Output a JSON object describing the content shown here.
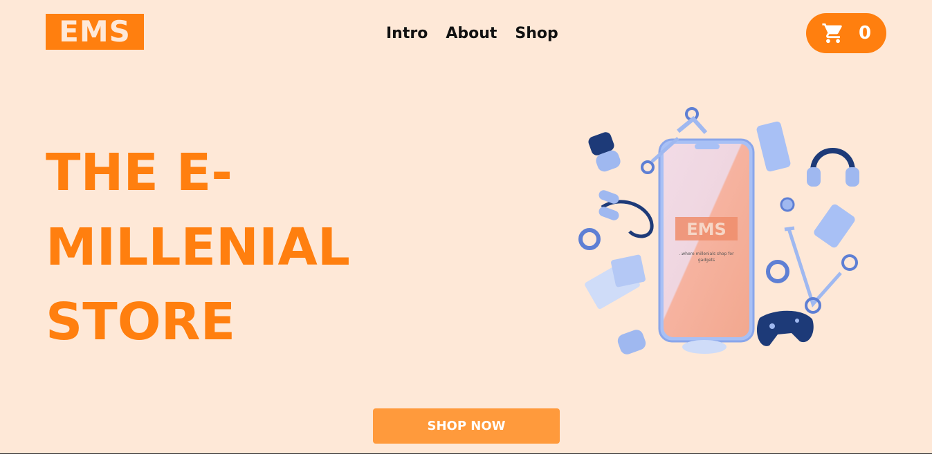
{
  "header": {
    "logo_text": "EMS",
    "nav": [
      {
        "label": "Intro"
      },
      {
        "label": "About"
      },
      {
        "label": "Shop"
      }
    ],
    "cart": {
      "icon": "cart-icon",
      "count": "0"
    }
  },
  "hero": {
    "title_lines": [
      "THE E-",
      "MILLENIAL",
      "STORE"
    ],
    "phone_logo": "EMS",
    "phone_tagline_line1": "..where millenials shop for",
    "phone_tagline_line2": "gadgets"
  },
  "cta": {
    "label": "SHOP NOW"
  },
  "colors": {
    "background": "#fee8d7",
    "accent": "#ff7f0f",
    "button": "#ff9a3c",
    "gadget_blue": "#9fb8f0"
  }
}
